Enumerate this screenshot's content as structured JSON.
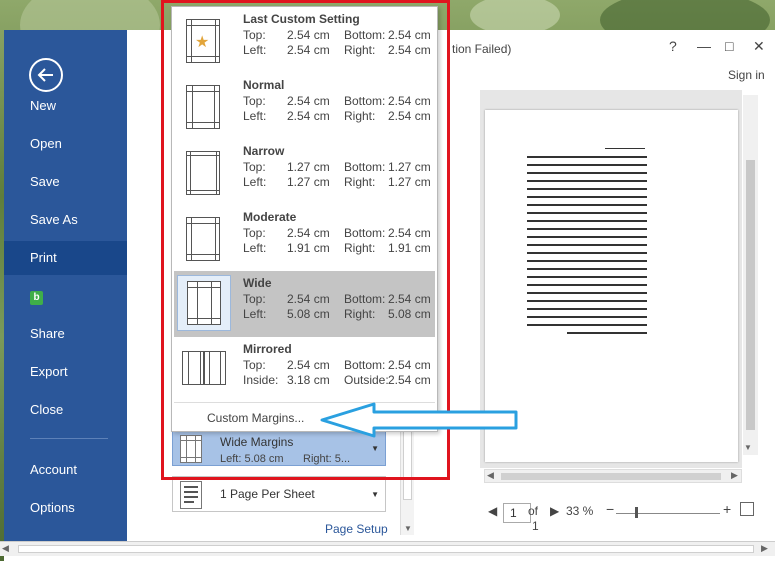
{
  "window": {
    "title_fragment": "tion Failed)",
    "help": "?",
    "minimize": "—",
    "restore": "□",
    "close": "✕",
    "sign_in": "Sign in"
  },
  "backstage": {
    "items": [
      {
        "label": "New"
      },
      {
        "label": "Open"
      },
      {
        "label": "Save"
      },
      {
        "label": "Save As"
      },
      {
        "label": "Print"
      },
      {
        "label": "b"
      },
      {
        "label": "Share"
      },
      {
        "label": "Export"
      },
      {
        "label": "Close"
      },
      {
        "label": "Account"
      },
      {
        "label": "Options"
      }
    ],
    "active": "Print"
  },
  "margins_gallery": {
    "items": [
      {
        "name": "Last Custom Setting",
        "label1": "Top:",
        "val1": "2.54 cm",
        "label2": "Bottom:",
        "val2": "2.54 cm",
        "label3": "Left:",
        "val3": "2.54 cm",
        "label4": "Right:",
        "val4": "2.54 cm"
      },
      {
        "name": "Normal",
        "label1": "Top:",
        "val1": "2.54 cm",
        "label2": "Bottom:",
        "val2": "2.54 cm",
        "label3": "Left:",
        "val3": "2.54 cm",
        "label4": "Right:",
        "val4": "2.54 cm"
      },
      {
        "name": "Narrow",
        "label1": "Top:",
        "val1": "1.27 cm",
        "label2": "Bottom:",
        "val2": "1.27 cm",
        "label3": "Left:",
        "val3": "1.27 cm",
        "label4": "Right:",
        "val4": "1.27 cm"
      },
      {
        "name": "Moderate",
        "label1": "Top:",
        "val1": "2.54 cm",
        "label2": "Bottom:",
        "val2": "2.54 cm",
        "label3": "Left:",
        "val3": "1.91 cm",
        "label4": "Right:",
        "val4": "1.91 cm"
      },
      {
        "name": "Wide",
        "label1": "Top:",
        "val1": "2.54 cm",
        "label2": "Bottom:",
        "val2": "2.54 cm",
        "label3": "Left:",
        "val3": "5.08 cm",
        "label4": "Right:",
        "val4": "5.08 cm"
      },
      {
        "name": "Mirrored",
        "label1": "Top:",
        "val1": "2.54 cm",
        "label2": "Bottom:",
        "val2": "2.54 cm",
        "label3": "Inside:",
        "val3": "3.18 cm",
        "label4": "Outside:",
        "val4": "2.54 cm"
      }
    ],
    "selected": "Wide",
    "custom_margins": "Custom Margins..."
  },
  "settings": {
    "margins_box": {
      "title": "Wide Margins",
      "left": "Left:  5.08 cm",
      "right": "Right:  5..."
    },
    "pages_box": {
      "title": "1 Page Per Sheet"
    },
    "page_setup": "Page Setup"
  },
  "preview": {
    "page_current": "1",
    "of": "of",
    "page_total": "1",
    "zoom": "33 %",
    "zoom_level": 0.33
  },
  "colors": {
    "backstage": "#2b579a",
    "highlight_box": "#e0141e",
    "arrow": "#2aa0e0",
    "selected_gallery": "#c4c4c4"
  }
}
